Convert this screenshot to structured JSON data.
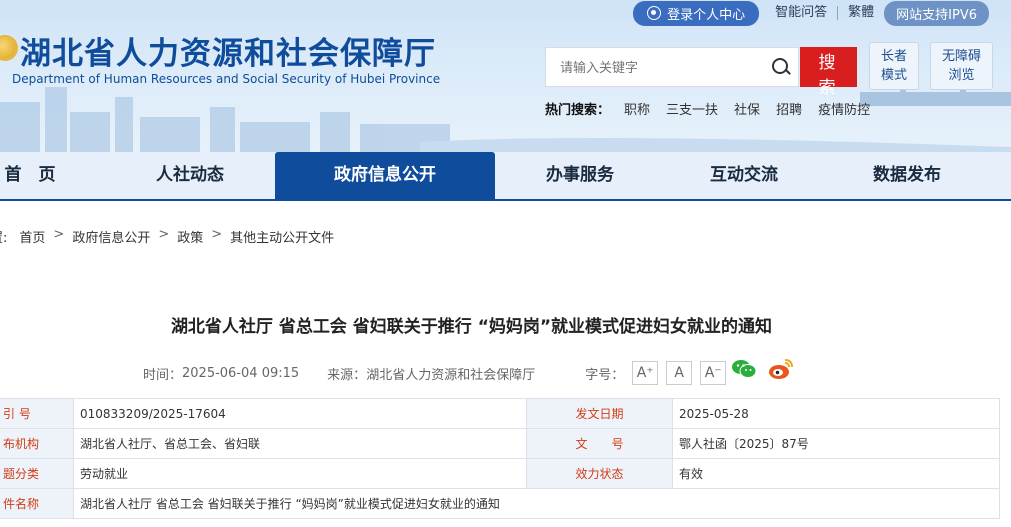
{
  "header": {
    "title": "湖北省人力资源和社会保障厅",
    "subtitle": "Department of Human Resources and Social Security of Hubei Province",
    "top_links": {
      "login": "登录个人中心",
      "qa": "智能问答",
      "traditional": "繁體",
      "ipv6": "网站支持IPV6"
    },
    "search": {
      "placeholder": "请输入关键字",
      "button": "搜 索"
    },
    "elder_mode": [
      "长者",
      "模式"
    ],
    "accessible": [
      "无障碍",
      "浏览"
    ],
    "hot_search": {
      "label": "热门搜索：",
      "items": [
        "职称",
        "三支一扶",
        "社保",
        "招聘",
        "疫情防控"
      ]
    }
  },
  "nav": {
    "items": [
      "首　页",
      "人社动态",
      "政府信息公开",
      "办事服务",
      "互动交流",
      "数据发布"
    ],
    "active": "政府信息公开"
  },
  "breadcrumb": {
    "prefix": "置:",
    "items": [
      "首页",
      "政府信息公开",
      "政策",
      "其他主动公开文件"
    ],
    "separator": ">"
  },
  "article": {
    "title": "湖北省人社厅 省总工会 省妇联关于推行 “妈妈岗”就业模式促进妇女就业的通知",
    "time_label": "时间：",
    "time": "2025-06-04 09:15",
    "source_label": "来源：",
    "source": "湖北省人力资源和社会保障厅",
    "font_size_label": "字号：",
    "font_buttons": [
      "A⁺",
      "A",
      "A⁻"
    ]
  },
  "info_table": {
    "rows": [
      {
        "k1": "引  号",
        "v1": "010833209/2025-17604",
        "k2": "发文日期",
        "v2": "2025-05-28"
      },
      {
        "k1": "布机构",
        "v1": "湖北省人社厅、省总工会、省妇联",
        "k2": "文　　号",
        "v2": "鄂人社函〔2025〕87号"
      },
      {
        "k1": "题分类",
        "v1": "劳动就业",
        "k2": "效力状态",
        "v2": "有效"
      },
      {
        "k1": "件名称",
        "v1": "湖北省人社厅 省总工会 省妇联关于推行 “妈妈岗”就业模式促进妇女就业的通知"
      }
    ]
  },
  "colors": {
    "brand_blue": "#0f4c9c",
    "search_red": "#d81e1e",
    "table_key": "#d03c16"
  },
  "icons": [
    "user-circle-icon",
    "search-icon",
    "wechat-icon",
    "weibo-icon",
    "provincial-emblem-icon"
  ]
}
